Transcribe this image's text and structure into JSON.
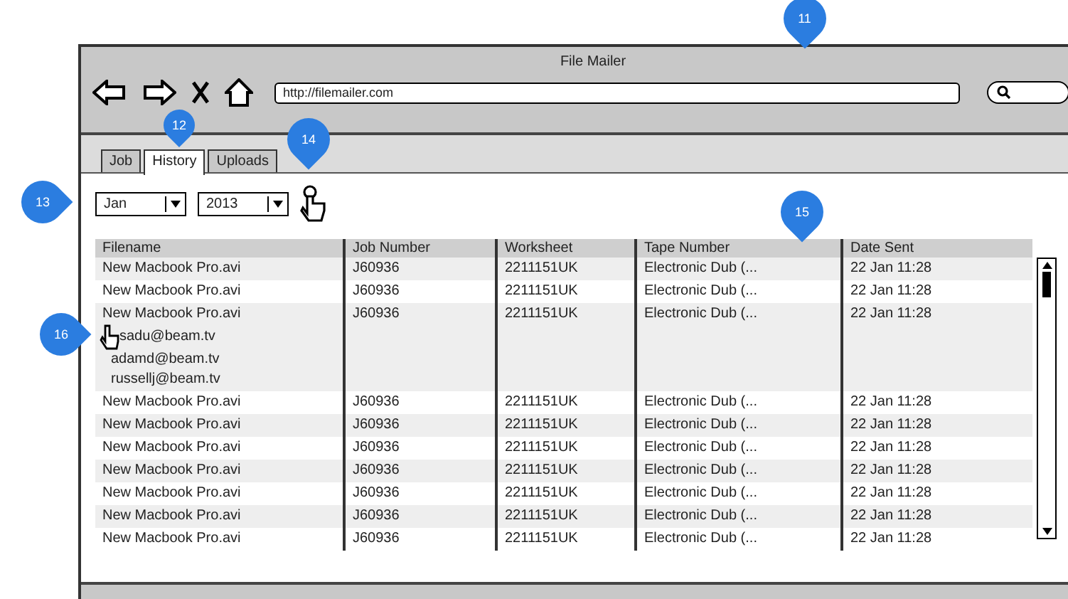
{
  "window": {
    "title": "File Mailer"
  },
  "address_bar": {
    "value": "http://filemailer.com"
  },
  "tabs": [
    {
      "label": "Job",
      "selected": false
    },
    {
      "label": "History",
      "selected": true
    },
    {
      "label": "Uploads",
      "selected": false
    }
  ],
  "filters": {
    "month": "Jan",
    "year": "2013"
  },
  "table": {
    "columns": [
      "Filename",
      "Job Number",
      "Worksheet",
      "Tape Number",
      "Date Sent"
    ],
    "rows": [
      {
        "cells": [
          "New Macbook Pro.avi",
          "J60936",
          "2211151UK",
          "Electronic Dub (...",
          "22 Jan 11:28"
        ]
      },
      {
        "cells": [
          "New Macbook Pro.avi",
          "J60936",
          "2211151UK",
          "Electronic Dub (...",
          "22 Jan 11:28"
        ]
      },
      {
        "cells": [
          "New Macbook Pro.avi",
          "J60936",
          "2211151UK",
          "Electronic Dub (...",
          "22 Jan 11:28"
        ],
        "recipients": [
          "sadu@beam.tv",
          "adamd@beam.tv",
          "russellj@beam.tv"
        ]
      },
      {
        "cells": [
          "New Macbook Pro.avi",
          "J60936",
          "2211151UK",
          "Electronic Dub (...",
          "22 Jan 11:28"
        ]
      },
      {
        "cells": [
          "New Macbook Pro.avi",
          "J60936",
          "2211151UK",
          "Electronic Dub (...",
          "22 Jan 11:28"
        ]
      },
      {
        "cells": [
          "New Macbook Pro.avi",
          "J60936",
          "2211151UK",
          "Electronic Dub (...",
          "22 Jan 11:28"
        ]
      },
      {
        "cells": [
          "New Macbook Pro.avi",
          "J60936",
          "2211151UK",
          "Electronic Dub (...",
          "22 Jan 11:28"
        ]
      },
      {
        "cells": [
          "New Macbook Pro.avi",
          "J60936",
          "2211151UK",
          "Electronic Dub (...",
          "22 Jan 11:28"
        ]
      },
      {
        "cells": [
          "New Macbook Pro.avi",
          "J60936",
          "2211151UK",
          "Electronic Dub (...",
          "22 Jan 11:28"
        ]
      },
      {
        "cells": [
          "New Macbook Pro.avi",
          "J60936",
          "2211151UK",
          "Electronic Dub (...",
          "22 Jan 11:28"
        ]
      }
    ]
  },
  "callouts": [
    {
      "label": "11",
      "kind": "down"
    },
    {
      "label": "12",
      "kind": "down"
    },
    {
      "label": "13",
      "kind": "right"
    },
    {
      "label": "14",
      "kind": "down"
    },
    {
      "label": "15",
      "kind": "down"
    },
    {
      "label": "16",
      "kind": "right"
    }
  ]
}
